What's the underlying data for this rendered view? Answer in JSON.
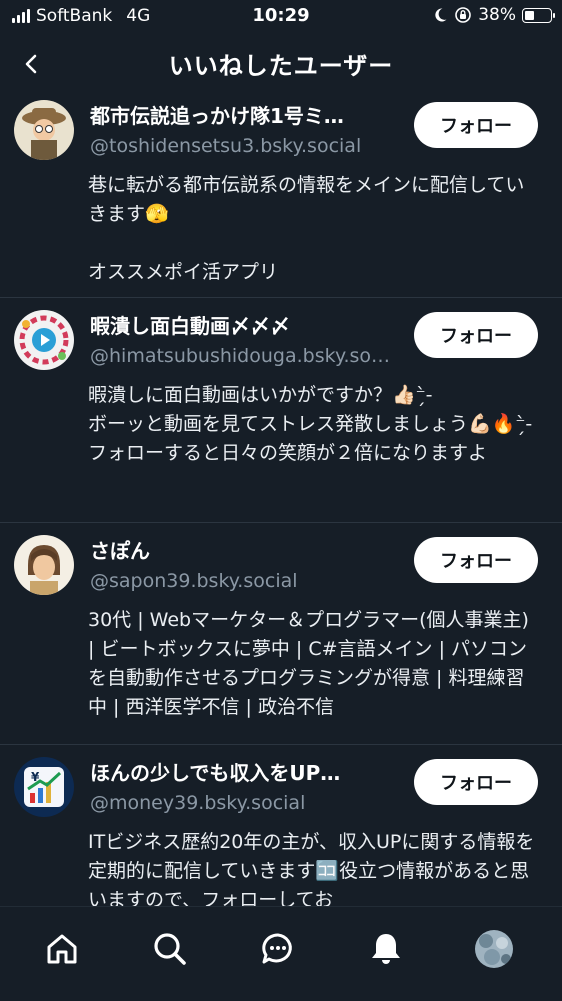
{
  "status_bar": {
    "carrier": "SoftBank",
    "network": "4G",
    "time": "10:29",
    "battery": "38%",
    "battery_level": 0.38
  },
  "header": {
    "title": "いいねしたユーザー",
    "back_icon": "chevron-left-icon"
  },
  "users": [
    {
      "name": "都市伝説追っかけ隊1号ミ…",
      "handle": "@toshidensetsu3.bsky.social",
      "follow_label": "フォロー",
      "bio": "巷に転がる都市伝説系の情報をメインに配信していきます🫣\n\nオススメポイ活アプリ",
      "avatar_colors": [
        "#e9e2cf",
        "#7a5a3a"
      ]
    },
    {
      "name": "暇潰し面白動画〆〆〆",
      "handle": "@himatsubushidouga.bsky.social",
      "follow_label": "フォロー",
      "bio": "暇潰しに面白動画はいかがですか？👍🏻⁻̗̀-\nボーッと動画を見てストレス発散しましょう💪🏻🔥⁻̗̀-\nフォローすると日々の笑顔が２倍になりますよ",
      "avatar_colors": [
        "#f2f2f2",
        "#d23b5a"
      ]
    },
    {
      "name": "さぽん",
      "handle": "@sapon39.bsky.social",
      "follow_label": "フォロー",
      "bio": "30代 | Webマーケター＆プログラマー(個人事業主) | ビートボックスに夢中 | C#言語メイン | パソコンを自動動作させるプログラミングが得意 | 料理練習中 | 西洋医学不信 | 政治不信",
      "avatar_colors": [
        "#f4efe4",
        "#6b4a2f"
      ]
    },
    {
      "name": "ほんの少しでも収入をUP…",
      "handle": "@money39.bsky.social",
      "follow_label": "フォロー",
      "bio": "ITビジネス歴約20年の主が、収入UPに関する情報を定期的に配信していきます🈁役立つ情報があると思いますので、フォローしてお",
      "avatar_colors": [
        "#0d2a52",
        "#e0b23a"
      ]
    }
  ],
  "tab_bar": {
    "items": [
      "home-icon",
      "search-icon",
      "chat-icon",
      "bell-icon",
      "profile-avatar"
    ],
    "active": "bell-icon"
  }
}
